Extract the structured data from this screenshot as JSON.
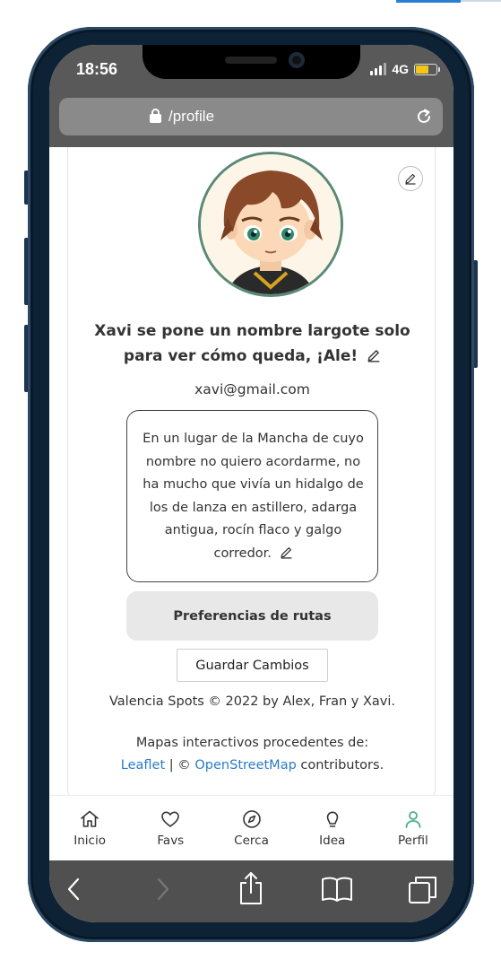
{
  "status_bar": {
    "time": "18:56",
    "network": "4G"
  },
  "url_bar": {
    "url": "/profile"
  },
  "profile": {
    "name": "Xavi se pone un nombre largote solo para ver cómo queda, ¡Ale!",
    "email": "xavi@gmail.com",
    "bio": "En un lugar de la Mancha de cuyo nombre no quiero acordarme, no ha mucho que vivía un hidalgo de los de lanza en astillero, adarga antigua, rocín flaco y galgo corredor.",
    "preferences_button": "Preferencias de rutas",
    "save_button": "Guardar Cambios"
  },
  "footer": {
    "copyright": "Valencia Spots © 2022 by Alex, Fran y Xavi.",
    "maps_prefix": "Mapas interactivos procedentes de:",
    "leaflet_link": "Leaflet",
    "separator": "| ©",
    "osm_link": "OpenStreetMap",
    "suffix": "contributors."
  },
  "app_nav": {
    "items": [
      {
        "label": "Inicio",
        "icon": "home-icon"
      },
      {
        "label": "Favs",
        "icon": "heart-icon"
      },
      {
        "label": "Cerca",
        "icon": "compass-icon"
      },
      {
        "label": "Idea",
        "icon": "lightbulb-icon"
      },
      {
        "label": "Perfil",
        "icon": "user-icon"
      }
    ],
    "active": "Perfil",
    "active_color": "#4caf83"
  },
  "colors": {
    "link": "#2b7cc9",
    "avatar_border": "#5a8a76",
    "browser_chrome": "#595959"
  }
}
